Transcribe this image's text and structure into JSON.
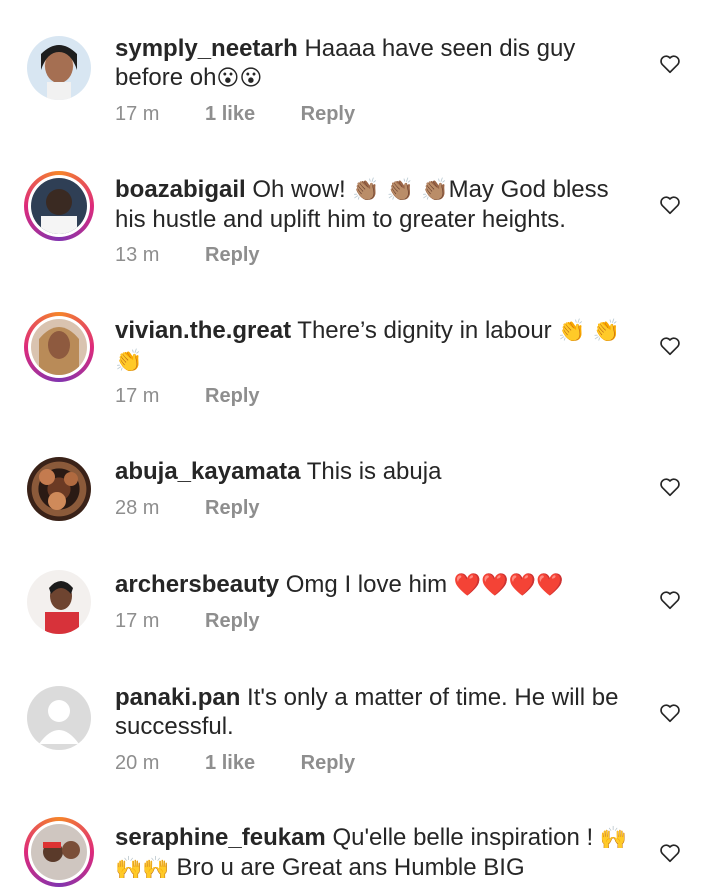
{
  "comments": [
    {
      "username": "symply_neetarh",
      "text": "Haaaa have seen dis guy before oh",
      "emoji": "😮😮",
      "time": "17 m",
      "likes": "1 like",
      "reply": "Reply"
    },
    {
      "username": "boazabigail",
      "text_before": "Oh wow!",
      "emoji": "👏🏽 👏🏽 👏🏽",
      "text": "May God bless his hustle and uplift him to greater heights.",
      "time": "13 m",
      "reply": "Reply"
    },
    {
      "username": "vivian.the.great",
      "text": "There’s dignity in labour",
      "emoji": "👏 👏 👏",
      "time": "17 m",
      "reply": "Reply"
    },
    {
      "username": "abuja_kayamata",
      "text": "This is abuja",
      "time": "28 m",
      "reply": "Reply"
    },
    {
      "username": "archersbeauty",
      "text": "Omg I love him",
      "emoji": "❤️❤️❤️❤️",
      "time": "17 m",
      "reply": "Reply"
    },
    {
      "username": "panaki.pan",
      "text": "It's only a matter of time.  He will be successful.",
      "time": "20 m",
      "likes": "1 like",
      "reply": "Reply"
    },
    {
      "username": "seraphine_feukam",
      "text": "Qu'elle belle inspiration !",
      "emoji": "🙌🙌🙌",
      "text_after": "Bro u are Great ans Humble BIG"
    }
  ]
}
